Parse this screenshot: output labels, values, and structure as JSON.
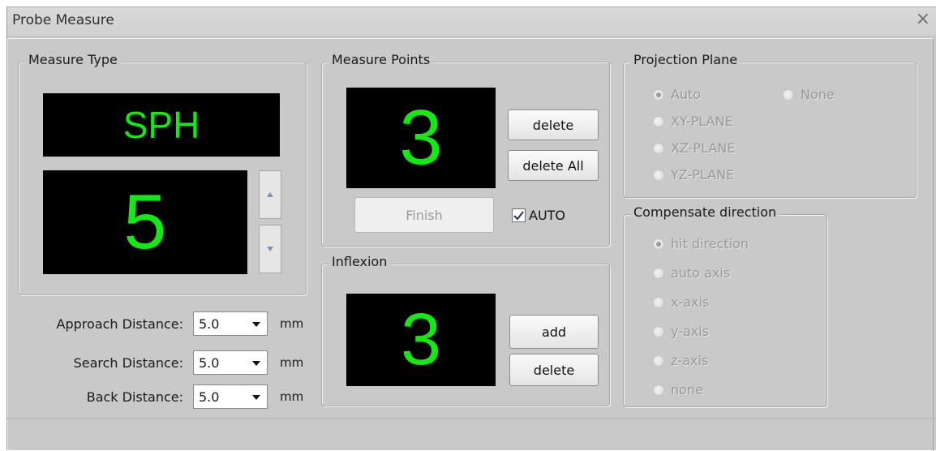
{
  "window": {
    "title": "Probe Measure",
    "close_glyph": "×"
  },
  "measure_type": {
    "legend": "Measure Type",
    "type_display": "SPH",
    "count_display": "5",
    "spin_up_icon": "triangle-up-icon",
    "spin_down_icon": "triangle-down-icon"
  },
  "distances": {
    "approach": {
      "label": "Approach Distance:",
      "value": "5.0",
      "unit": "mm"
    },
    "search": {
      "label": "Search Distance:",
      "value": "5.0",
      "unit": "mm"
    },
    "back": {
      "label": "Back Distance:",
      "value": "5.0",
      "unit": "mm"
    }
  },
  "measure_points": {
    "legend": "Measure Points",
    "count_display": "3",
    "delete_label": "delete",
    "delete_all_label": "delete All",
    "finish_label": "Finish",
    "auto_label": "AUTO",
    "auto_checked": true
  },
  "inflexion": {
    "legend": "Inflexion",
    "count_display": "3",
    "add_label": "add",
    "delete_label": "delete"
  },
  "projection_plane": {
    "legend": "Projection Plane",
    "options": [
      "Auto",
      "None",
      "XY-PLANE",
      "XZ-PLANE",
      "YZ-PLANE"
    ],
    "selected": "Auto"
  },
  "compensate_direction": {
    "legend": "Compensate direction",
    "options": [
      "hit direction",
      "auto axis",
      "x-axis",
      "y-axis",
      "z-axis",
      "none"
    ],
    "selected": "hit direction"
  },
  "colors": {
    "lcd_background": "#000000",
    "lcd_digits": "#16e816",
    "dialog_background": "#c9c9c9",
    "disabled_text": "#989898"
  }
}
